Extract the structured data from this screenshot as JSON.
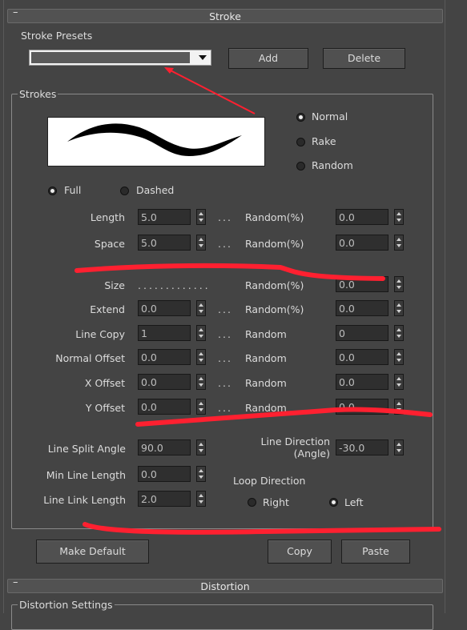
{
  "stroke_rollout": {
    "title": "Stroke",
    "collapse_symbol": "–"
  },
  "presets": {
    "group_label": "Stroke Presets",
    "dropdown_value": "",
    "add_label": "Add",
    "delete_label": "Delete"
  },
  "strokes": {
    "group_label": "Strokes",
    "style_options": [
      {
        "label": "Normal",
        "selected": true
      },
      {
        "label": "Rake",
        "selected": false
      },
      {
        "label": "Random",
        "selected": false
      }
    ],
    "line_options": [
      {
        "label": "Full",
        "selected": true
      },
      {
        "label": "Dashed",
        "selected": false
      }
    ],
    "params": {
      "length": {
        "label": "Length",
        "value": "5.0",
        "sep": "...",
        "rand_label": "Random(%)",
        "rand_value": "0.0"
      },
      "space": {
        "label": "Space",
        "value": "5.0",
        "sep": "...",
        "rand_label": "Random(%)",
        "rand_value": "0.0"
      },
      "size": {
        "label": "Size",
        "dots": ".............",
        "rand_label": "Random(%)",
        "rand_value": "0.0"
      },
      "extend": {
        "label": "Extend",
        "value": "0.0",
        "sep": "...",
        "rand_label": "Random(%)",
        "rand_value": "0.0"
      },
      "line_copy": {
        "label": "Line Copy",
        "value": "1",
        "sep": "...",
        "rand_label": "Random",
        "rand_value": "0"
      },
      "normal_offset": {
        "label": "Normal Offset",
        "value": "0.0",
        "sep": "...",
        "rand_label": "Random",
        "rand_value": "0.0"
      },
      "x_offset": {
        "label": "X Offset",
        "value": "0.0",
        "sep": "...",
        "rand_label": "Random",
        "rand_value": "0.0"
      },
      "y_offset": {
        "label": "Y Offset",
        "value": "0.0",
        "sep": "...",
        "rand_label": "Random",
        "rand_value": "0.0"
      }
    },
    "line_split_angle": {
      "label": "Line Split Angle",
      "value": "90.0"
    },
    "min_line_length": {
      "label": "Min Line Length",
      "value": "0.0"
    },
    "line_link_length": {
      "label": "Line Link Length",
      "value": "2.0"
    },
    "line_direction": {
      "label_line1": "Line Direction",
      "label_line2": "(Angle)",
      "value": "-30.0"
    },
    "loop_direction": {
      "label": "Loop Direction",
      "options": [
        {
          "label": "Right",
          "selected": false
        },
        {
          "label": "Left",
          "selected": true
        }
      ]
    }
  },
  "buttons": {
    "make_default": "Make Default",
    "copy": "Copy",
    "paste": "Paste"
  },
  "distortion_rollout": {
    "title": "Distortion",
    "collapse_symbol": "–",
    "group_label": "Distortion Settings"
  },
  "colors": {
    "background": "#444444",
    "annotation_red": "#ff2030"
  }
}
